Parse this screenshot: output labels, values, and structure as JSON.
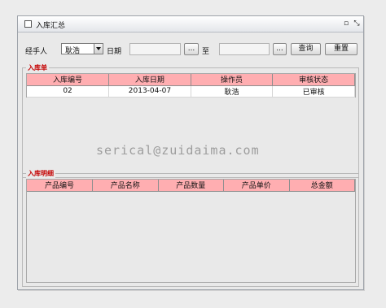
{
  "window": {
    "title": "入库汇总",
    "restore_glyph": "▫",
    "close_glyph": "⤡"
  },
  "filters": {
    "handler_label": "经手人",
    "handler_value": "耿浩",
    "date_label": "日期",
    "date_browse_label": "...",
    "to_label": "至",
    "to_browse_label": "...",
    "query_label": "查询",
    "reset_label": "重置"
  },
  "inbound_panel": {
    "legend": "入库单",
    "columns": [
      "入库编号",
      "入库日期",
      "操作员",
      "审核状态"
    ],
    "rows": [
      [
        "02",
        "2013-04-07",
        "耿浩",
        "已审核"
      ]
    ]
  },
  "detail_panel": {
    "legend": "入库明细",
    "columns": [
      "产品编号",
      "产品名称",
      "产品数量",
      "产品单价",
      "总金额"
    ]
  },
  "watermark": "serical@zuidaima.com",
  "colors": {
    "header_pink": "#ffaeb1",
    "legend_red": "#c40000"
  }
}
